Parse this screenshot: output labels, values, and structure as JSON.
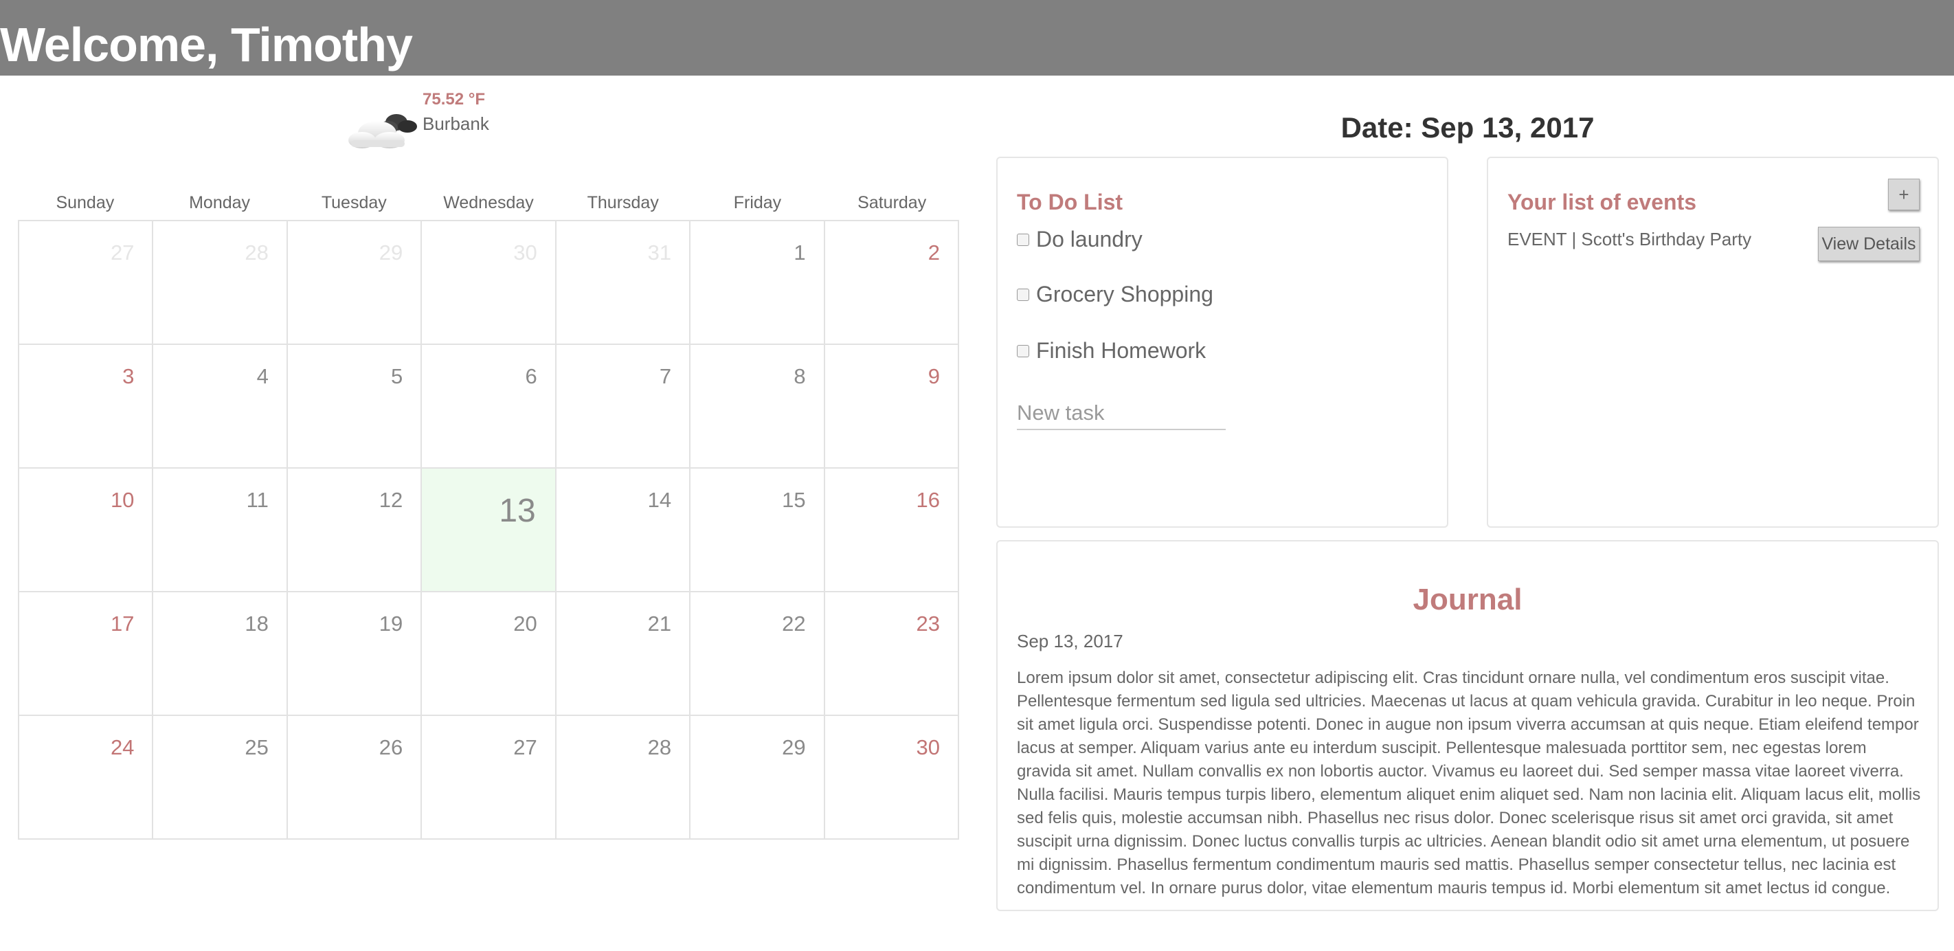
{
  "header": {
    "title": "Welcome, Timothy"
  },
  "weather": {
    "temperature": "75.52 °F",
    "city": "Burbank",
    "icon": "cloud-icon"
  },
  "calendar": {
    "day_names": [
      "Sunday",
      "Monday",
      "Tuesday",
      "Wednesday",
      "Thursday",
      "Friday",
      "Saturday"
    ],
    "weeks": [
      [
        {
          "n": "27",
          "t": "other"
        },
        {
          "n": "28",
          "t": "other"
        },
        {
          "n": "29",
          "t": "other"
        },
        {
          "n": "30",
          "t": "other"
        },
        {
          "n": "31",
          "t": "other"
        },
        {
          "n": "1",
          "t": ""
        },
        {
          "n": "2",
          "t": "weekend"
        }
      ],
      [
        {
          "n": "3",
          "t": "weekend"
        },
        {
          "n": "4",
          "t": ""
        },
        {
          "n": "5",
          "t": ""
        },
        {
          "n": "6",
          "t": ""
        },
        {
          "n": "7",
          "t": ""
        },
        {
          "n": "8",
          "t": ""
        },
        {
          "n": "9",
          "t": "weekend"
        }
      ],
      [
        {
          "n": "10",
          "t": "weekend"
        },
        {
          "n": "11",
          "t": ""
        },
        {
          "n": "12",
          "t": ""
        },
        {
          "n": "13",
          "t": "today"
        },
        {
          "n": "14",
          "t": ""
        },
        {
          "n": "15",
          "t": ""
        },
        {
          "n": "16",
          "t": "weekend"
        }
      ],
      [
        {
          "n": "17",
          "t": "weekend"
        },
        {
          "n": "18",
          "t": ""
        },
        {
          "n": "19",
          "t": ""
        },
        {
          "n": "20",
          "t": ""
        },
        {
          "n": "21",
          "t": ""
        },
        {
          "n": "22",
          "t": ""
        },
        {
          "n": "23",
          "t": "weekend"
        }
      ],
      [
        {
          "n": "24",
          "t": "weekend"
        },
        {
          "n": "25",
          "t": ""
        },
        {
          "n": "26",
          "t": ""
        },
        {
          "n": "27",
          "t": ""
        },
        {
          "n": "28",
          "t": ""
        },
        {
          "n": "29",
          "t": ""
        },
        {
          "n": "30",
          "t": "weekend"
        }
      ]
    ]
  },
  "date_title": "Date: Sep 13, 2017",
  "todo": {
    "title": "To Do List",
    "tasks": [
      "Do laundry",
      "Grocery Shopping",
      "Finish Homework"
    ],
    "new_task_placeholder": "New task"
  },
  "events": {
    "title": "Your list of events",
    "add_label": "+",
    "items": [
      {
        "text": "EVENT | Scott's Birthday Party",
        "button": "View Details"
      }
    ]
  },
  "journal": {
    "title": "Journal",
    "date": "Sep 13, 2017",
    "body": "Lorem ipsum dolor sit amet, consectetur adipiscing elit. Cras tincidunt ornare nulla, vel condimentum eros suscipit vitae. Pellentesque fermentum sed ligula sed ultricies. Maecenas ut lacus at quam vehicula gravida. Curabitur in leo neque. Proin sit amet ligula orci. Suspendisse potenti. Donec in augue non ipsum viverra accumsan at quis neque. Etiam eleifend tempor lacus at semper. Aliquam varius ante eu interdum suscipit. Pellentesque malesuada porttitor sem, nec egestas lorem gravida sit amet. Nullam convallis ex non lobortis auctor. Vivamus eu laoreet dui. Sed semper massa vitae laoreet viverra. Nulla facilisi. Mauris tempus turpis libero, elementum aliquet enim aliquet sed. Nam non lacinia elit. Aliquam lacus elit, mollis sed felis quis, molestie accumsan nibh. Phasellus nec risus dolor. Donec scelerisque risus sit amet orci gravida, sit amet suscipit urna dignissim. Donec luctus convallis turpis ac ultricies. Aenean blandit odio sit amet urna elementum, ut posuere mi dignissim. Phasellus fermentum condimentum mauris sed mattis. Phasellus semper consectetur tellus, nec lacinia est condimentum vel. In ornare purus dolor, vitae elementum mauris tempus id. Morbi elementum sit amet lectus id congue."
  },
  "colors": {
    "header_bg": "#808080",
    "accent": "#c07b7b",
    "today_bg": "#eefbee"
  }
}
